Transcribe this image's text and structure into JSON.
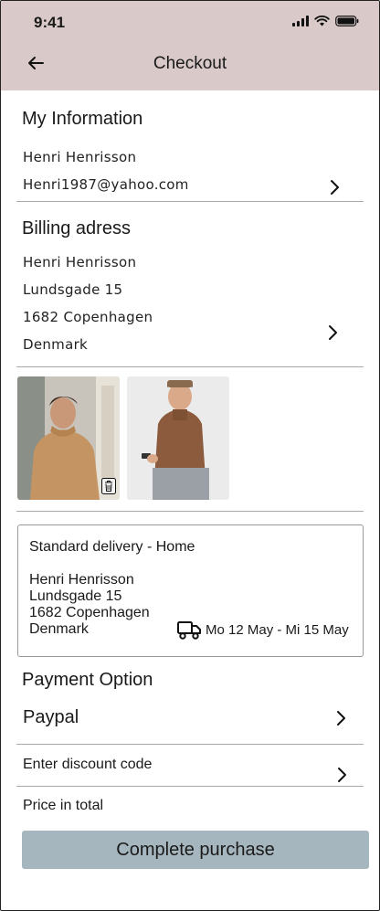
{
  "status_bar": {
    "time": "9:41"
  },
  "header": {
    "title": "Checkout"
  },
  "my_information": {
    "title": "My Information",
    "name": "Henri Henrisson",
    "email": "Henri1987@yahoo.com"
  },
  "billing": {
    "title": "Billing adress",
    "name": "Henri Henrisson",
    "street": "Lundsgade 15",
    "city": "1682 Copenhagen",
    "country": "Denmark"
  },
  "delivery": {
    "title": "Standard delivery - Home",
    "name": "Henri Henrisson",
    "street": "Lundsgade 15",
    "city": "1682 Copenhagen",
    "country": "Denmark",
    "dates": "Mo 12 May - Mi 15 May"
  },
  "payment": {
    "title": "Payment Option",
    "selected": "Paypal"
  },
  "discount": {
    "label": "Enter discount code"
  },
  "price": {
    "label": "Price in total"
  },
  "actions": {
    "complete_label": "Complete purchase"
  },
  "colors": {
    "header_bg": "#d9c9c9",
    "button_bg": "#a6b6bf"
  }
}
